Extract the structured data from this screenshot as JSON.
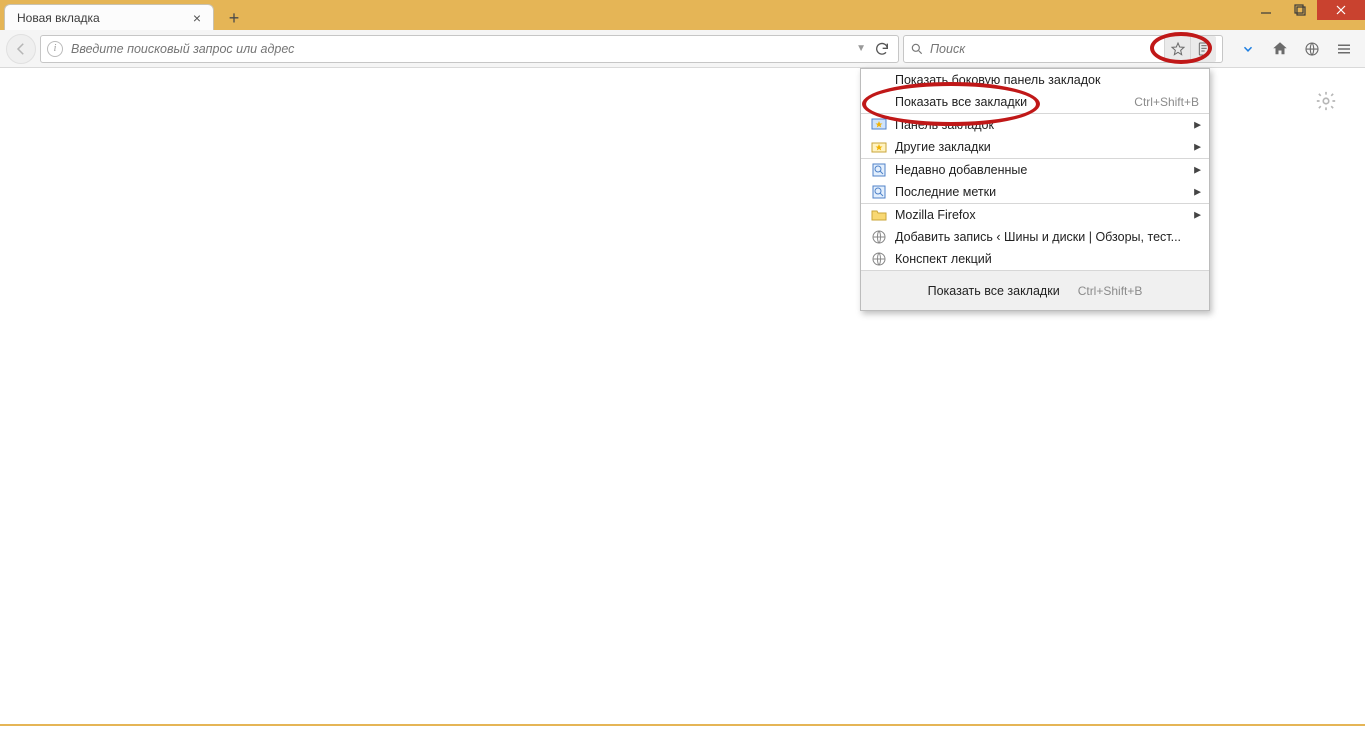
{
  "window": {
    "minimize_tip": "Свернуть",
    "maximize_tip": "Развернуть",
    "close_tip": "Закрыть"
  },
  "tab": {
    "title": "Новая вкладка"
  },
  "urlbar": {
    "placeholder": "Введите поисковый запрос или адрес"
  },
  "searchbar": {
    "placeholder": "Поиск"
  },
  "menu": {
    "show_sidebar": "Показать боковую панель закладок",
    "show_all": {
      "label": "Показать все закладки",
      "accel": "Ctrl+Shift+B"
    },
    "toolbar": "Панель закладок",
    "other": "Другие закладки",
    "recent": "Недавно добавленные",
    "tags": "Последние метки",
    "folder_firefox": "Mozilla Firefox",
    "bm_tires": "Добавить запись ‹ Шины и диски | Обзоры, тест...",
    "bm_lectures": "Конспект лекций",
    "footer": {
      "label": "Показать все закладки",
      "accel": "Ctrl+Shift+B"
    }
  }
}
